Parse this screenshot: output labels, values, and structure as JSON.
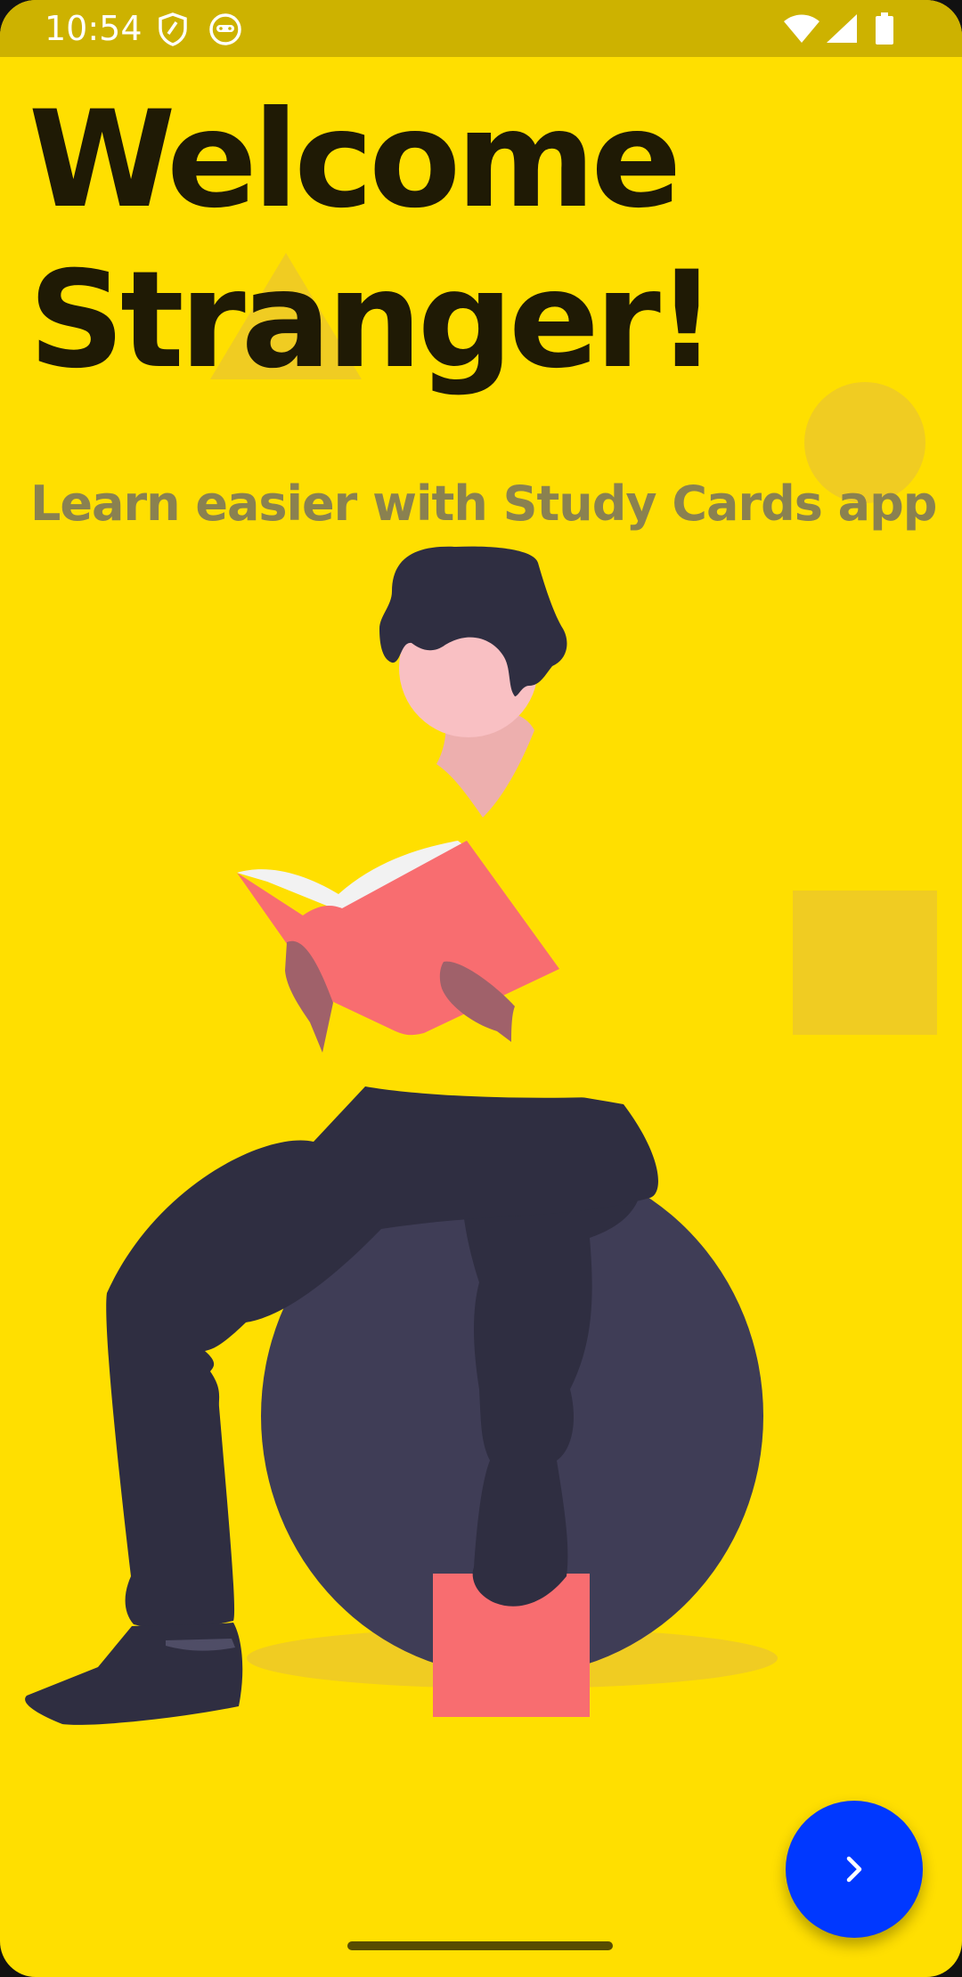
{
  "status_bar": {
    "time": "10:54",
    "icons": [
      "shield-icon",
      "android-icon",
      "wifi-icon",
      "signal-icon",
      "battery-icon"
    ]
  },
  "welcome": {
    "title_line1": "Welcome",
    "title_line2": "Stranger!",
    "subtitle": "Learn easier with Study Cards app"
  },
  "illustration": "person-reading-book-on-exercise-ball",
  "fab": {
    "icon": "chevron-right-icon"
  },
  "colors": {
    "background": "#FFDF00",
    "status_bar": "#CDB200",
    "title": "#1F1A05",
    "subtitle": "#8A8150",
    "fab": "#0038FF",
    "book": "#F86D70",
    "dark": "#2F2E41",
    "ball": "#3F3D56"
  }
}
